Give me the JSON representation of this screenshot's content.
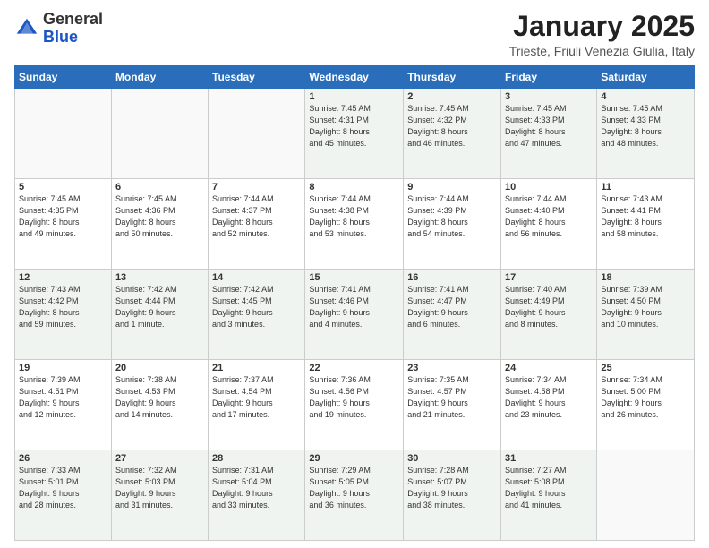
{
  "logo": {
    "general": "General",
    "blue": "Blue"
  },
  "header": {
    "title": "January 2025",
    "subtitle": "Trieste, Friuli Venezia Giulia, Italy"
  },
  "weekdays": [
    "Sunday",
    "Monday",
    "Tuesday",
    "Wednesday",
    "Thursday",
    "Friday",
    "Saturday"
  ],
  "weeks": [
    [
      {
        "day": "",
        "info": ""
      },
      {
        "day": "",
        "info": ""
      },
      {
        "day": "",
        "info": ""
      },
      {
        "day": "1",
        "info": "Sunrise: 7:45 AM\nSunset: 4:31 PM\nDaylight: 8 hours\nand 45 minutes."
      },
      {
        "day": "2",
        "info": "Sunrise: 7:45 AM\nSunset: 4:32 PM\nDaylight: 8 hours\nand 46 minutes."
      },
      {
        "day": "3",
        "info": "Sunrise: 7:45 AM\nSunset: 4:33 PM\nDaylight: 8 hours\nand 47 minutes."
      },
      {
        "day": "4",
        "info": "Sunrise: 7:45 AM\nSunset: 4:33 PM\nDaylight: 8 hours\nand 48 minutes."
      }
    ],
    [
      {
        "day": "5",
        "info": "Sunrise: 7:45 AM\nSunset: 4:35 PM\nDaylight: 8 hours\nand 49 minutes."
      },
      {
        "day": "6",
        "info": "Sunrise: 7:45 AM\nSunset: 4:36 PM\nDaylight: 8 hours\nand 50 minutes."
      },
      {
        "day": "7",
        "info": "Sunrise: 7:44 AM\nSunset: 4:37 PM\nDaylight: 8 hours\nand 52 minutes."
      },
      {
        "day": "8",
        "info": "Sunrise: 7:44 AM\nSunset: 4:38 PM\nDaylight: 8 hours\nand 53 minutes."
      },
      {
        "day": "9",
        "info": "Sunrise: 7:44 AM\nSunset: 4:39 PM\nDaylight: 8 hours\nand 54 minutes."
      },
      {
        "day": "10",
        "info": "Sunrise: 7:44 AM\nSunset: 4:40 PM\nDaylight: 8 hours\nand 56 minutes."
      },
      {
        "day": "11",
        "info": "Sunrise: 7:43 AM\nSunset: 4:41 PM\nDaylight: 8 hours\nand 58 minutes."
      }
    ],
    [
      {
        "day": "12",
        "info": "Sunrise: 7:43 AM\nSunset: 4:42 PM\nDaylight: 8 hours\nand 59 minutes."
      },
      {
        "day": "13",
        "info": "Sunrise: 7:42 AM\nSunset: 4:44 PM\nDaylight: 9 hours\nand 1 minute."
      },
      {
        "day": "14",
        "info": "Sunrise: 7:42 AM\nSunset: 4:45 PM\nDaylight: 9 hours\nand 3 minutes."
      },
      {
        "day": "15",
        "info": "Sunrise: 7:41 AM\nSunset: 4:46 PM\nDaylight: 9 hours\nand 4 minutes."
      },
      {
        "day": "16",
        "info": "Sunrise: 7:41 AM\nSunset: 4:47 PM\nDaylight: 9 hours\nand 6 minutes."
      },
      {
        "day": "17",
        "info": "Sunrise: 7:40 AM\nSunset: 4:49 PM\nDaylight: 9 hours\nand 8 minutes."
      },
      {
        "day": "18",
        "info": "Sunrise: 7:39 AM\nSunset: 4:50 PM\nDaylight: 9 hours\nand 10 minutes."
      }
    ],
    [
      {
        "day": "19",
        "info": "Sunrise: 7:39 AM\nSunset: 4:51 PM\nDaylight: 9 hours\nand 12 minutes."
      },
      {
        "day": "20",
        "info": "Sunrise: 7:38 AM\nSunset: 4:53 PM\nDaylight: 9 hours\nand 14 minutes."
      },
      {
        "day": "21",
        "info": "Sunrise: 7:37 AM\nSunset: 4:54 PM\nDaylight: 9 hours\nand 17 minutes."
      },
      {
        "day": "22",
        "info": "Sunrise: 7:36 AM\nSunset: 4:56 PM\nDaylight: 9 hours\nand 19 minutes."
      },
      {
        "day": "23",
        "info": "Sunrise: 7:35 AM\nSunset: 4:57 PM\nDaylight: 9 hours\nand 21 minutes."
      },
      {
        "day": "24",
        "info": "Sunrise: 7:34 AM\nSunset: 4:58 PM\nDaylight: 9 hours\nand 23 minutes."
      },
      {
        "day": "25",
        "info": "Sunrise: 7:34 AM\nSunset: 5:00 PM\nDaylight: 9 hours\nand 26 minutes."
      }
    ],
    [
      {
        "day": "26",
        "info": "Sunrise: 7:33 AM\nSunset: 5:01 PM\nDaylight: 9 hours\nand 28 minutes."
      },
      {
        "day": "27",
        "info": "Sunrise: 7:32 AM\nSunset: 5:03 PM\nDaylight: 9 hours\nand 31 minutes."
      },
      {
        "day": "28",
        "info": "Sunrise: 7:31 AM\nSunset: 5:04 PM\nDaylight: 9 hours\nand 33 minutes."
      },
      {
        "day": "29",
        "info": "Sunrise: 7:29 AM\nSunset: 5:05 PM\nDaylight: 9 hours\nand 36 minutes."
      },
      {
        "day": "30",
        "info": "Sunrise: 7:28 AM\nSunset: 5:07 PM\nDaylight: 9 hours\nand 38 minutes."
      },
      {
        "day": "31",
        "info": "Sunrise: 7:27 AM\nSunset: 5:08 PM\nDaylight: 9 hours\nand 41 minutes."
      },
      {
        "day": "",
        "info": ""
      }
    ]
  ]
}
